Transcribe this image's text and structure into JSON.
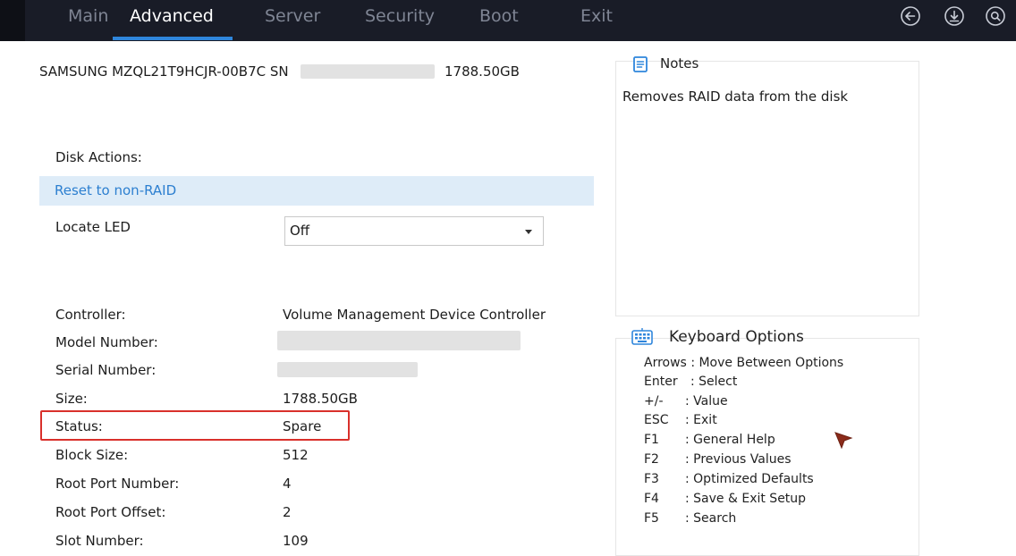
{
  "menu": {
    "tabs": [
      {
        "label": "Main"
      },
      {
        "label": "Advanced"
      },
      {
        "label": "Server"
      },
      {
        "label": "Security"
      },
      {
        "label": "Boot"
      },
      {
        "label": "Exit"
      }
    ],
    "active_tab": "Advanced",
    "icons": [
      "back-icon",
      "save-icon",
      "search-icon"
    ]
  },
  "disk": {
    "header_model": "SAMSUNG MZQL21T9HCJR-00B7C SN",
    "header_size": "1788.50GB"
  },
  "actions": {
    "section_label": "Disk Actions:",
    "reset_label": "Reset to non-RAID",
    "locate_led_label": "Locate LED",
    "locate_led_value": "Off"
  },
  "info": {
    "controller_label": "Controller:",
    "controller_value": "Volume Management Device Controller",
    "model_label": "Model Number:",
    "serial_label": "Serial Number:",
    "size_label": "Size:",
    "size_value": "1788.50GB",
    "status_label": "Status:",
    "status_value": "Spare",
    "block_label": "Block Size:",
    "block_value": "512",
    "root_port_label": "Root Port Number:",
    "root_port_value": "4",
    "root_offset_label": "Root Port Offset:",
    "root_offset_value": "2",
    "slot_label": "Slot Number:",
    "slot_value": "109"
  },
  "notes": {
    "title": "Notes",
    "text": "Removes RAID data from the disk"
  },
  "keyboard": {
    "title": "Keyboard Options",
    "items": [
      {
        "key": "Arrows",
        "desc": ": Move Between Options"
      },
      {
        "key": "Enter",
        "desc": ": Select"
      },
      {
        "key": "+/-",
        "desc": ": Value"
      },
      {
        "key": "ESC",
        "desc": ": Exit"
      },
      {
        "key": "F1",
        "desc": ": General Help"
      },
      {
        "key": "F2",
        "desc": ": Previous Values"
      },
      {
        "key": "F3",
        "desc": ": Optimized Defaults"
      },
      {
        "key": "F4",
        "desc": ": Save & Exit Setup"
      },
      {
        "key": "F5",
        "desc": ": Search"
      }
    ]
  },
  "colors": {
    "menubar": "#191c27",
    "accent": "#2f86dc",
    "highlight": "#deecf8",
    "status_border": "#d9302b"
  }
}
